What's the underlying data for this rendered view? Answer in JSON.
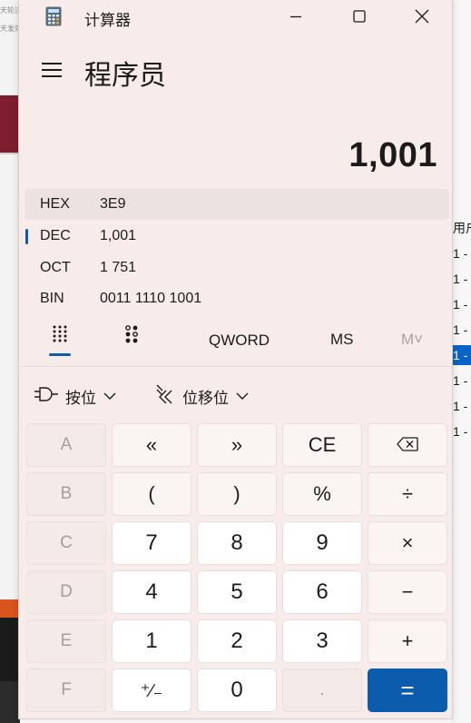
{
  "background_window": {
    "left_snippets": [
      "天轮过",
      "天发效"
    ],
    "right_header": "用户",
    "right_rows": [
      "1 -",
      "1 -",
      "1 -",
      "1 -",
      "1 -",
      "1 -",
      "1 -",
      "1 -"
    ]
  },
  "window": {
    "title": "计算器",
    "icon": "calculator-icon",
    "controls": [
      "minimize-icon",
      "maximize-icon",
      "close-icon"
    ]
  },
  "nav": {
    "menu_icon": "hamburger-menu-icon",
    "mode_title": "程序员"
  },
  "display": {
    "value": "1,001"
  },
  "radix": {
    "selected": "DEC",
    "rows": [
      {
        "name": "HEX",
        "value": "3E9"
      },
      {
        "name": "DEC",
        "value": "1,001"
      },
      {
        "name": "OCT",
        "value": "1 751"
      },
      {
        "name": "BIN",
        "value": "0011 1110 1001"
      }
    ]
  },
  "tabs": {
    "keypad_icon": "full-keypad-icon",
    "bit_toggle_icon": "bit-toggling-keypad-icon",
    "word_size": "QWORD",
    "memory_store": "MS",
    "memory_recall": "M˅"
  },
  "bitwise": {
    "bitwise_label": "按位",
    "bitwise_icon": "logic-gate-icon",
    "shift_label": "位移位",
    "shift_icon": "bit-shift-icon"
  },
  "keypad": {
    "rows": [
      [
        "A",
        "«",
        "»",
        "CE",
        "⌫"
      ],
      [
        "B",
        "(",
        ")",
        "%",
        "÷"
      ],
      [
        "C",
        "7",
        "8",
        "9",
        "×"
      ],
      [
        "D",
        "4",
        "5",
        "6",
        "−"
      ],
      [
        "E",
        "1",
        "2",
        "3",
        "+"
      ],
      [
        "F",
        "⁺∕₋",
        "0",
        ".",
        "="
      ]
    ]
  },
  "colors": {
    "accent": "#0b5cad",
    "window_bg": "#f7ece9",
    "selected_bg_row": "#0a64c8"
  }
}
